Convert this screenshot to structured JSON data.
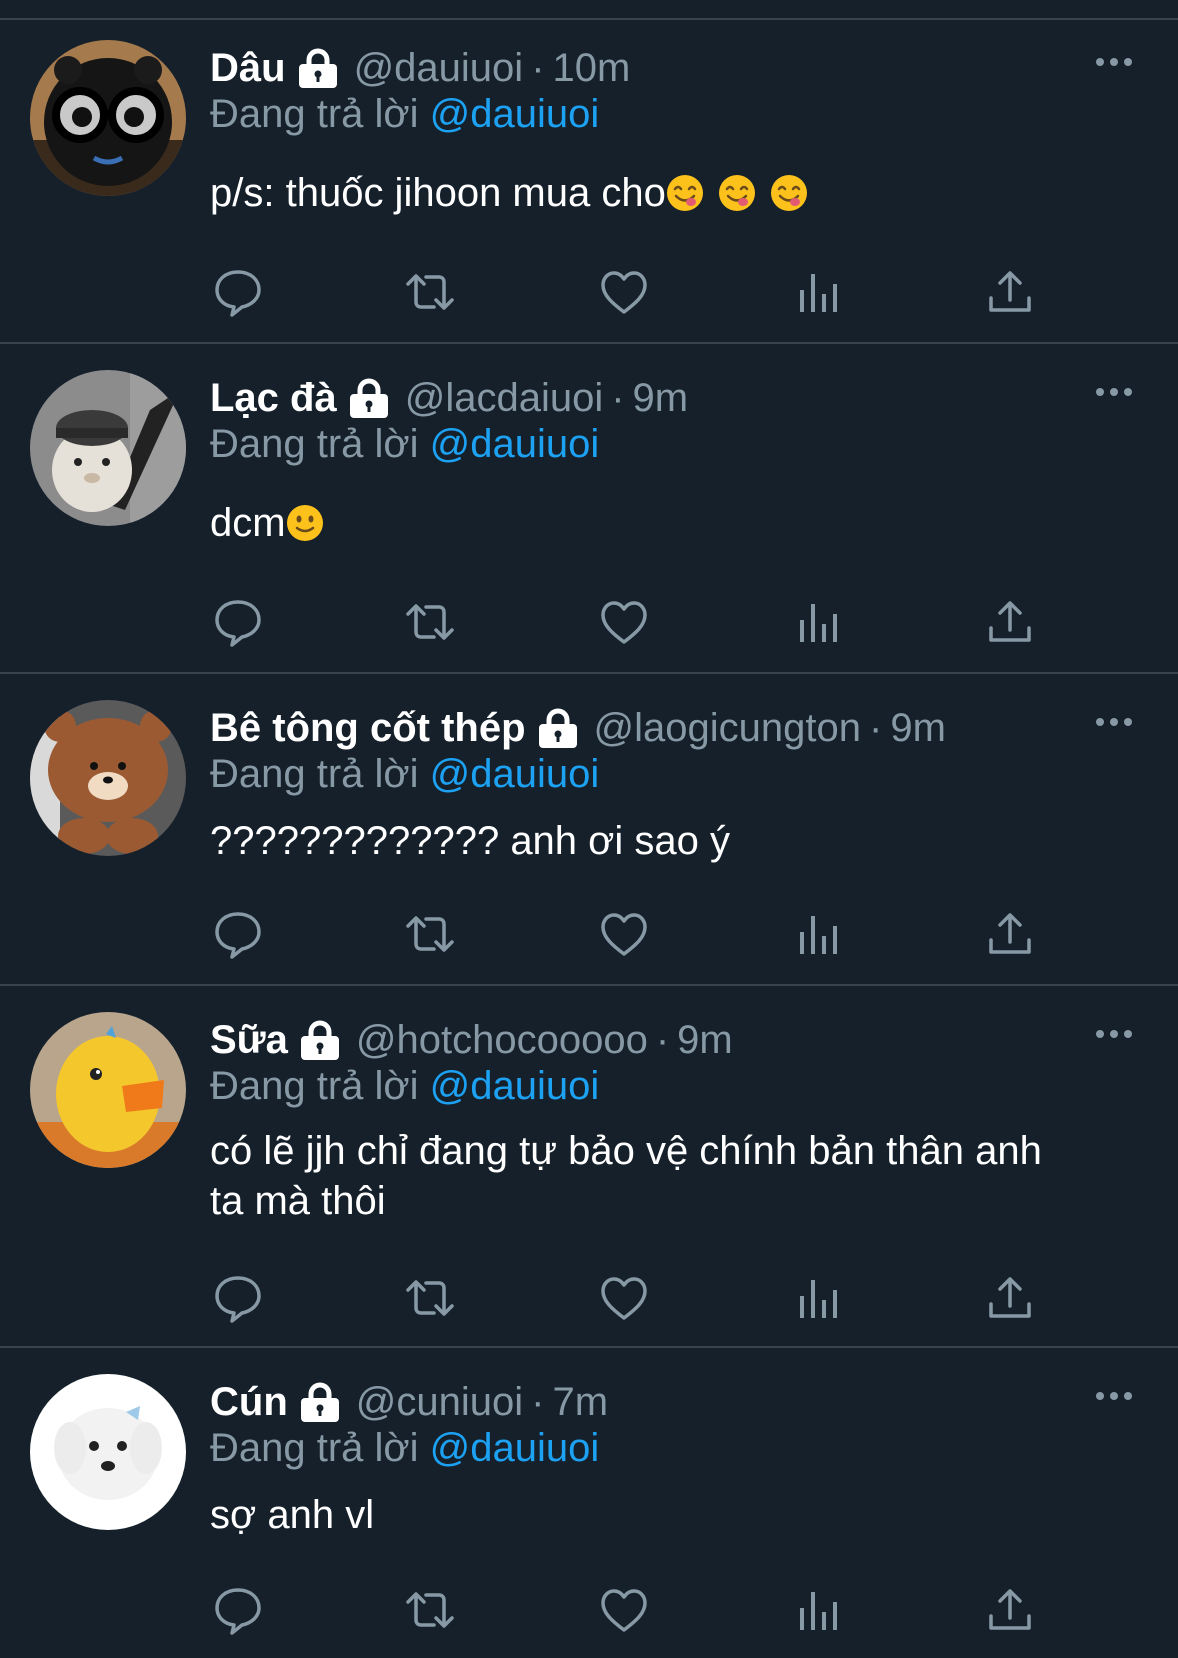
{
  "colors": {
    "background": "#15202b",
    "divider": "#38444d",
    "secondary_text": "#8899a6",
    "mention": "#1da1f2"
  },
  "tweets": [
    {
      "name": "Dâu",
      "handle": "@dauiuoi",
      "dot": "·",
      "time": "10m",
      "reply_prefix": "Đang trả lời",
      "reply_to": "@dauiuoi",
      "text": "p/s: thuốc jihoon mua cho",
      "emoji": [
        "savoring-face",
        "savoring-face",
        "savoring-face"
      ],
      "avatar": "black-plush-with-glasses"
    },
    {
      "name": "Lạc đà",
      "handle": "@lacdaiuoi",
      "dot": "·",
      "time": "9m",
      "reply_prefix": "Đang trả lời",
      "reply_to": "@dauiuoi",
      "text": "dcm",
      "emoji": [
        "slightly-smiling-face"
      ],
      "avatar": "alpaca-with-cap"
    },
    {
      "name": "Bê tông cốt thép",
      "handle": "@laogicungton",
      "dot": "·",
      "time": "9m",
      "reply_prefix": "Đang trả lời",
      "reply_to": "@dauiuoi",
      "text": "????????????? anh ơi sao ý",
      "avatar": "brown-bear-plush"
    },
    {
      "name": "Sữa",
      "handle": "@hotchocooooo",
      "dot": "·",
      "time": "9m",
      "reply_prefix": "Đang trả lời",
      "reply_to": "@dauiuoi",
      "text_lines": [
        "có lẽ jjh chỉ đang tự bảo vệ chính bản thân anh",
        "ta mà thôi"
      ],
      "avatar": "yellow-duck"
    },
    {
      "name": "Cún",
      "handle": "@cuniuoi",
      "dot": "·",
      "time": "7m",
      "reply_prefix": "Đang trả lời",
      "reply_to": "@dauiuoi",
      "text": "sợ anh vl",
      "avatar": "white-puppy"
    }
  ],
  "icons": {
    "lock": "lock-icon",
    "more": "more-options-icon",
    "reply": "reply-icon",
    "retweet": "retweet-icon",
    "like": "heart-icon",
    "analytics": "analytics-icon",
    "share": "share-icon"
  }
}
